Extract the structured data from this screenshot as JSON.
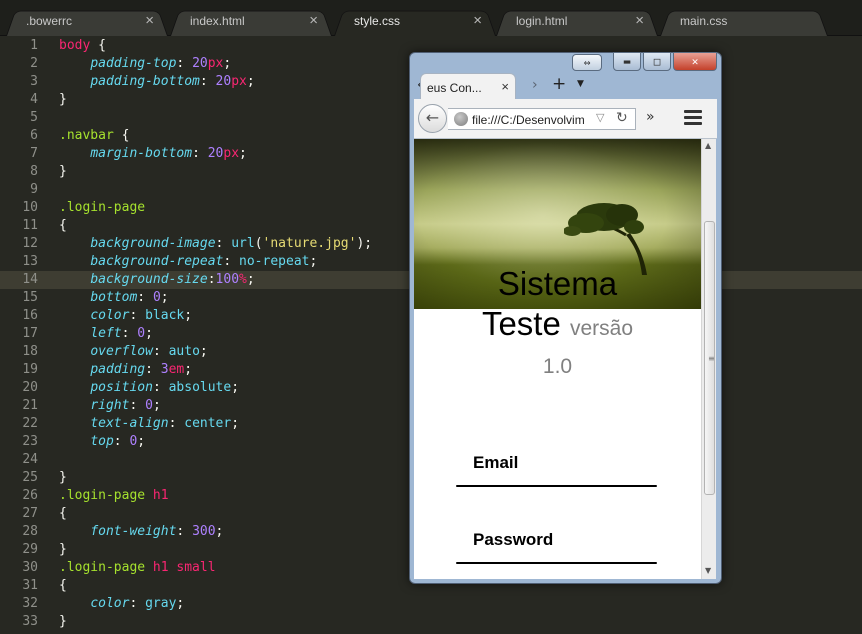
{
  "editor": {
    "tabs": [
      {
        "label": ".bowerrc",
        "close": "×"
      },
      {
        "label": "index.html",
        "close": "×"
      },
      {
        "label": "style.css",
        "close": "×"
      },
      {
        "label": "login.html",
        "close": "×"
      },
      {
        "label": "main.css",
        "close": "×"
      }
    ],
    "active_tab": "style.css",
    "current_line": 14,
    "line_numbers": [
      "1",
      "2",
      "3",
      "4",
      "5",
      "6",
      "7",
      "8",
      "9",
      "10",
      "11",
      "12",
      "13",
      "14",
      "15",
      "16",
      "17",
      "18",
      "19",
      "20",
      "21",
      "22",
      "23",
      "24",
      "25",
      "26",
      "27",
      "28",
      "29",
      "30",
      "31",
      "32",
      "33"
    ],
    "code": {
      "l1_sel": "body",
      "l1_brace": " {",
      "l2_prop": "padding-top",
      "l2_num": "20",
      "l2_unit": "px",
      "l3_prop": "padding-bottom",
      "l3_num": "20",
      "l3_unit": "px",
      "l4": "}",
      "l6_sel": ".navbar",
      "l6_brace": " {",
      "l7_prop": "margin-bottom",
      "l7_num": "20",
      "l7_unit": "px",
      "l8": "}",
      "l10_sel": ".login-page",
      "l11": "{",
      "l12_prop": "background-image",
      "l12_fn": "url",
      "l12_str": "'nature.jpg'",
      "l13_prop": "background-repeat",
      "l13_val": "no-repeat",
      "l14_prop": "background-size",
      "l14_num": "100",
      "l14_unit": "%",
      "l15_prop": "bottom",
      "l15_num": "0",
      "l16_prop": "color",
      "l16_val": "black",
      "l17_prop": "left",
      "l17_num": "0",
      "l18_prop": "overflow",
      "l18_val": "auto",
      "l19_prop": "padding",
      "l19_num": "3",
      "l19_unit": "em",
      "l20_prop": "position",
      "l20_val": "absolute",
      "l21_prop": "right",
      "l21_num": "0",
      "l22_prop": "text-align",
      "l22_val": "center",
      "l23_prop": "top",
      "l23_num": "0",
      "l25": "}",
      "l26_sel": ".login-page",
      "l26_tag": "h1",
      "l27": "{",
      "l28_prop": "font-weight",
      "l28_num": "300",
      "l29": "}",
      "l30_sel": ".login-page",
      "l30_tag": "h1 small",
      "l31": "{",
      "l32_prop": "color",
      "l32_val": "gray",
      "l33": "}"
    }
  },
  "browser": {
    "tab_title": "eus Con...",
    "tab_close": "×",
    "url": "file:///C:/Desenvolvim",
    "window_buttons": {
      "restore": "⇔",
      "minimize": "▬",
      "maximize": "□",
      "close": "✕"
    },
    "nav": {
      "back": "←",
      "tab_left": "‹",
      "tab_right": "›",
      "new_tab": "+",
      "tab_list": "▼",
      "bookmark": "▽",
      "reload": "↻",
      "overflow": "»"
    },
    "page": {
      "title_line1": "Sistema",
      "title_line2": "Teste",
      "version_word": "versão",
      "version_number": "1.0",
      "email_label": "Email",
      "password_label": "Password"
    },
    "scrollbar": {
      "up": "▲",
      "down": "▼",
      "grip": "≡"
    }
  },
  "colors": {
    "editor_bg": "#272822",
    "selector": "#a6e22e",
    "property": "#66d9ef",
    "number": "#ae81ff",
    "unit": "#f92672",
    "string": "#e6db74"
  },
  "icons": [
    "back-arrow-icon",
    "globe-icon",
    "reload-icon",
    "bookmark-icon",
    "hamburger-menu-icon",
    "close-icon"
  ]
}
